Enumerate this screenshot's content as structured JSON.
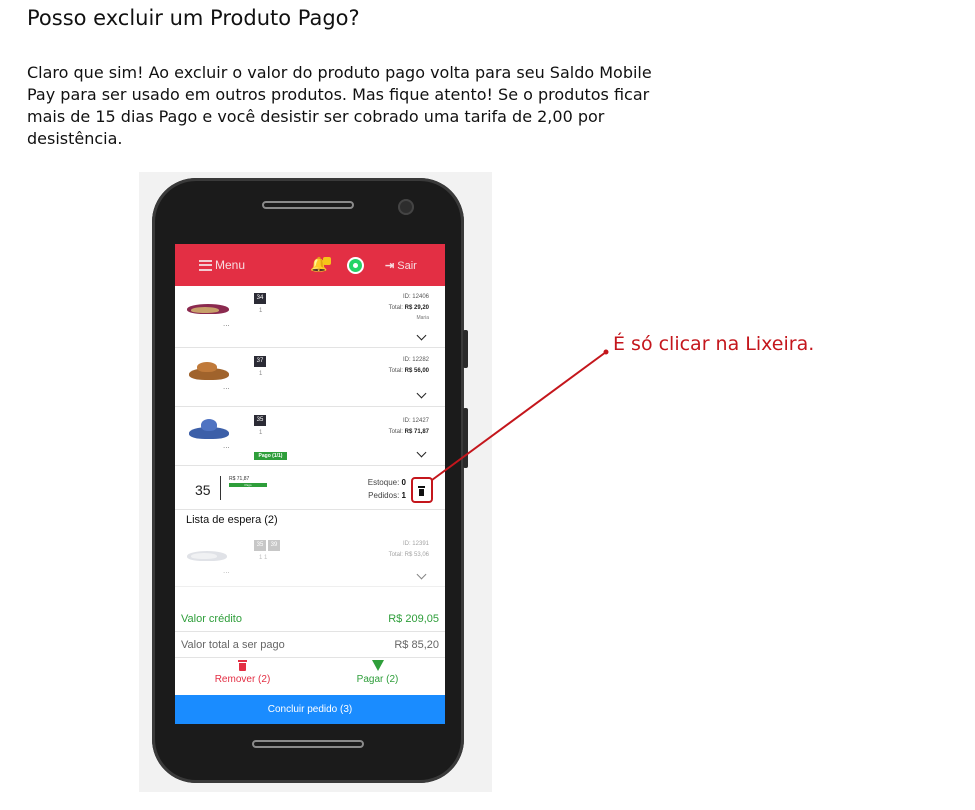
{
  "doc": {
    "title": "Posso excluir um Produto Pago?",
    "body": "Claro que sim! Ao excluir o valor do produto pago volta para seu Saldo Mobile Pay para ser usado em outros produtos. Mas fique atento! Se o produtos ficar mais de 15 dias Pago e você desistir ser cobrado uma tarifa de 2,00 por desistência."
  },
  "header": {
    "menu_label": "Menu",
    "logout_label": "Sair",
    "colors": {
      "background": "#e32f44",
      "badge": "#f5c518",
      "whatsapp": "#25d366"
    }
  },
  "items": [
    {
      "size": "34",
      "qty": "1",
      "id": "ID: 12406",
      "total_label": "Total:",
      "total": "R$ 29,20",
      "extra": "Maria",
      "dots": "..."
    },
    {
      "size": "37",
      "qty": "1",
      "id": "ID: 12282",
      "total_label": "Total:",
      "total": "R$ 56,00",
      "dots": "..."
    },
    {
      "size": "35",
      "qty": "1",
      "id": "ID: 12427",
      "total_label": "Total:",
      "total": "R$ 71,87",
      "dots": "...",
      "badge": "Pago (1/1)"
    }
  ],
  "detail": {
    "size": "35",
    "price": "R$ 71,87",
    "bar_label": "Pago",
    "stock_label": "Estoque:",
    "stock_value": "0",
    "orders_label": "Pedidos:",
    "orders_value": "1"
  },
  "waitlist": {
    "title": "Lista de espera (2)",
    "item": {
      "size_a": "35",
      "size_b": "39",
      "qty": "1   1",
      "id": "ID: 12391",
      "total_label": "Total:",
      "total": "R$ 53,06",
      "dots": "..."
    }
  },
  "summary": {
    "credit_label": "Valor crédito",
    "credit_value": "R$ 209,05",
    "total_label": "Valor total a ser pago",
    "total_value": "R$ 85,20"
  },
  "actions": {
    "remove_label": "Remover (2)",
    "pay_label": "Pagar (2)",
    "conclude_label": "Concluir pedido (3)",
    "colors": {
      "remove": "#e32f44",
      "pay": "#2e9e3a",
      "conclude": "#1a8cff"
    }
  },
  "annotation": {
    "text": "É só clicar na Lixeira.",
    "color": "#c4161c"
  }
}
